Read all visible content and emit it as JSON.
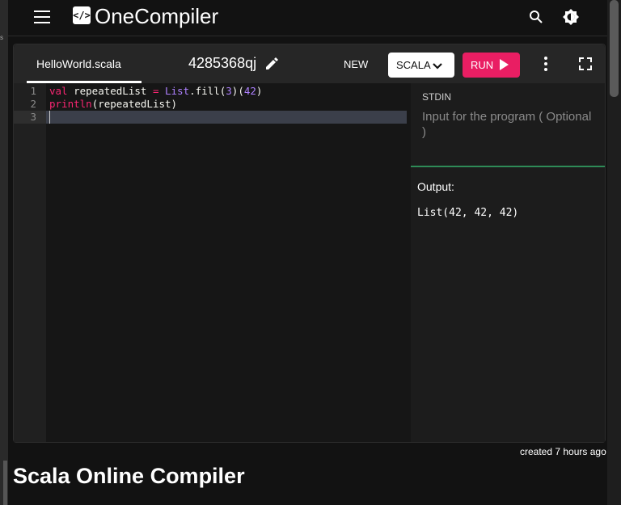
{
  "header": {
    "app_name": "OneCompiler",
    "logo_glyph": "</>"
  },
  "toolbar": {
    "file_tab": "HelloWorld.scala",
    "code_id": "4285368qj",
    "new_label": "NEW",
    "language": "SCALA",
    "run_label": "RUN"
  },
  "editor": {
    "line_numbers": [
      "1",
      "2",
      "3"
    ],
    "lines": [
      "val repeatedList = List.fill(3)(42)",
      "println(repeatedList)",
      ""
    ],
    "tokens": {
      "l1_val": "val",
      "l1_name": " repeatedList ",
      "l1_eq": "=",
      "l1_sp": " ",
      "l1_list": "List",
      "l1_fill": ".fill(",
      "l1_3": "3",
      "l1_mid": ")(",
      "l1_42": "42",
      "l1_end": ")",
      "l2_println": "println",
      "l2_rest": "(repeatedList)"
    }
  },
  "io": {
    "stdin_label": "STDIN",
    "stdin_placeholder": "Input for the program ( Optional )",
    "output_label": "Output:",
    "output_text": "List(42, 42, 42)"
  },
  "footer": {
    "created": "created 7 hours ago",
    "page_title": "Scala Online Compiler"
  },
  "colors": {
    "accent_run": "#e91e63",
    "divider": "#2e8b57"
  }
}
